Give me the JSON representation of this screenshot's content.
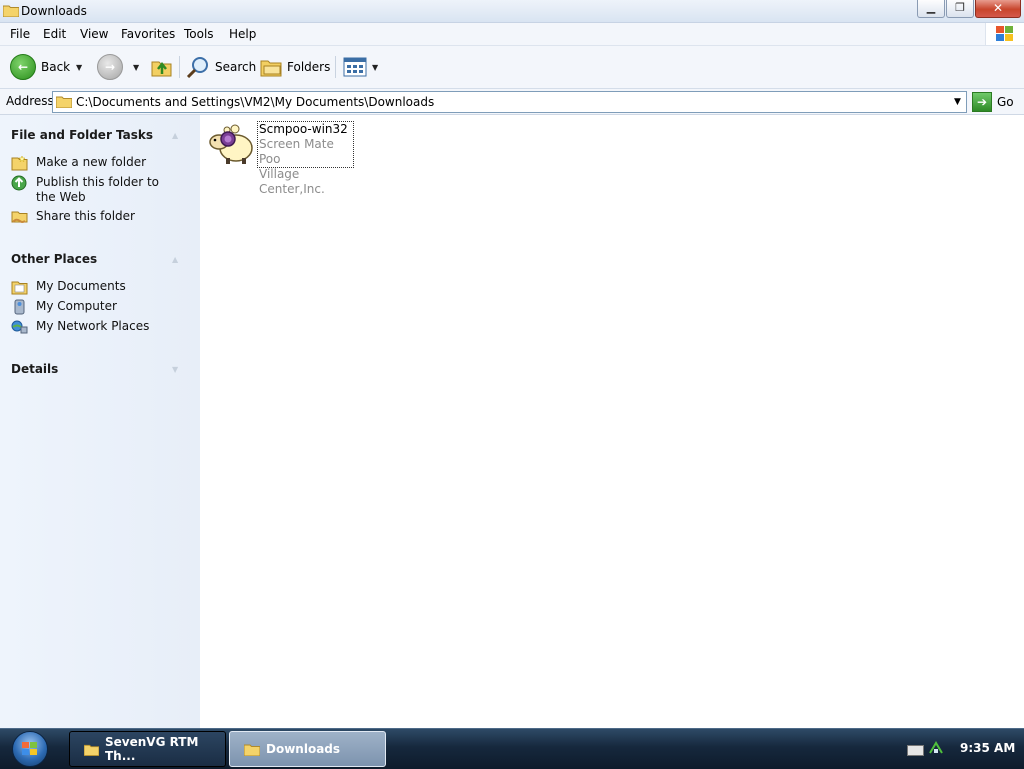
{
  "window": {
    "title": "Downloads"
  },
  "menu": [
    "File",
    "Edit",
    "View",
    "Favorites",
    "Tools",
    "Help"
  ],
  "toolbar": {
    "back": "Back",
    "search": "Search",
    "folders": "Folders"
  },
  "address": {
    "label": "Address",
    "path": "C:\\Documents and Settings\\VM2\\My Documents\\Downloads",
    "go": "Go"
  },
  "taskpane": {
    "file_tasks": {
      "title": "File and Folder Tasks",
      "items": [
        "Make a new folder",
        "Publish this folder to the Web",
        "Share this folder"
      ]
    },
    "other_places": {
      "title": "Other Places",
      "items": [
        "My Documents",
        "My Computer",
        "My Network Places"
      ]
    },
    "details": {
      "title": "Details"
    }
  },
  "files": [
    {
      "name": "Scmpoo-win32",
      "description": "Screen Mate Poo",
      "company": "Village Center,Inc."
    }
  ],
  "taskbar": {
    "items": [
      "SevenVG RTM Th...",
      "Downloads"
    ],
    "clock": "9:35 AM"
  }
}
